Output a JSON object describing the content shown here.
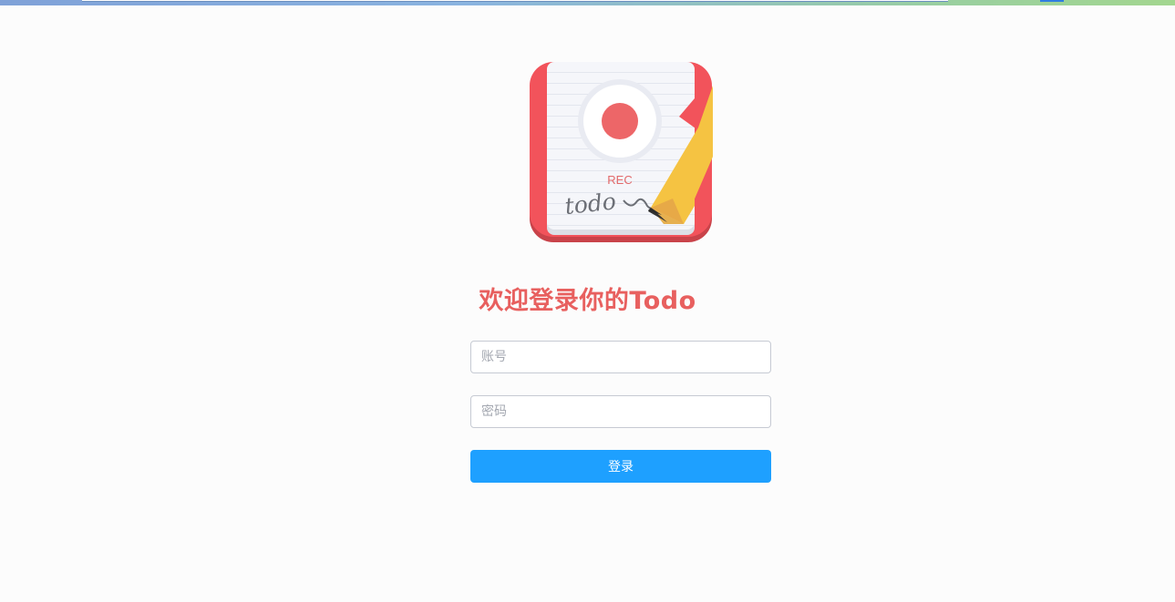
{
  "logo": {
    "rec_label": "REC",
    "handwriting": "todo"
  },
  "heading": "欢迎登录你的Todo",
  "form": {
    "account_placeholder": "账号",
    "password_placeholder": "密码",
    "submit_label": "登录"
  },
  "colors": {
    "title": "#e8605f",
    "button": "#1ea0ff",
    "logo_frame": "#f2535b",
    "pencil": "#f5c342"
  }
}
